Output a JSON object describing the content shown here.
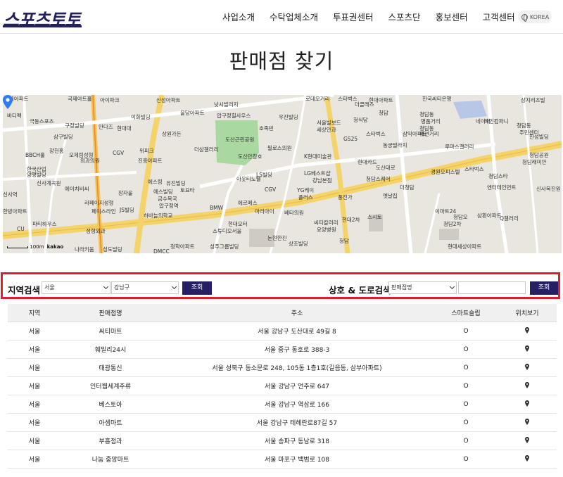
{
  "header": {
    "logo": "스포츠토토",
    "nav": [
      "사업소개",
      "수탁업체소개",
      "투표권센터",
      "스포츠단",
      "홍보센터",
      "고객센터"
    ],
    "lang": "KOREA"
  },
  "page_title": "판매점 찾기",
  "map": {
    "labels": [
      {
        "t": "현대아파트"
      },
      {
        "t": "국제아트홀"
      },
      {
        "t": "아이파크"
      },
      {
        "t": "신성아파트"
      },
      {
        "t": "낫시빌리지"
      },
      {
        "t": "로데오거리"
      },
      {
        "t": "스타벅스"
      },
      {
        "t": "현대아파트"
      },
      {
        "t": "한국씨티은행"
      },
      {
        "t": "상지리츠빌"
      },
      {
        "t": "바디펙"
      },
      {
        "t": "극동스포츠"
      },
      {
        "t": "구정빌딩"
      },
      {
        "t": "삼구빌딩"
      },
      {
        "t": "안다즈"
      },
      {
        "t": "현대대"
      },
      {
        "t": "이화빌딩"
      },
      {
        "t": "을당아파트"
      },
      {
        "t": "압구정힐사우스"
      },
      {
        "t": "우진빌딩"
      },
      {
        "t": "더클래스"
      },
      {
        "t": "청담"
      },
      {
        "t": "청담동"
      },
      {
        "t": "명품거리"
      },
      {
        "t": "청담동"
      },
      {
        "t": "패션거리"
      },
      {
        "t": "네이처"
      },
      {
        "t": "상원가든"
      },
      {
        "t": "호족빈"
      },
      {
        "t": "서울빌보드"
      },
      {
        "t": "세상안과"
      },
      {
        "t": "청식당"
      },
      {
        "t": "스타벅스"
      },
      {
        "t": "삼익아파트"
      },
      {
        "t": "레인컴파니"
      },
      {
        "t": "청담동"
      },
      {
        "t": "주민센터"
      },
      {
        "t": "한성빌딩"
      },
      {
        "t": "장천홍"
      },
      {
        "t": "모제림성형"
      },
      {
        "t": "외과의원"
      },
      {
        "t": "CGV"
      },
      {
        "t": "위피크"
      },
      {
        "t": "더삼갤러리"
      },
      {
        "t": "도산근린공원"
      },
      {
        "t": "필로스의원"
      },
      {
        "t": "GS25"
      },
      {
        "t": "동궁빌라지"
      },
      {
        "t": "루마스갤러리"
      },
      {
        "t": "BBCH홀"
      },
      {
        "t": "진흥아파트"
      },
      {
        "t": "도산안창호"
      },
      {
        "t": "K현대미술관"
      },
      {
        "t": "현대카드"
      },
      {
        "t": "청담공원"
      },
      {
        "t": "청담래미안"
      },
      {
        "t": "한국산업"
      },
      {
        "t": "양행빌딩"
      },
      {
        "t": "신사계곡원"
      },
      {
        "t": "에스림"
      },
      {
        "t": "LS빌딩"
      },
      {
        "t": "LG베스트샵"
      },
      {
        "t": "강남본점"
      },
      {
        "t": "도산대로"
      },
      {
        "t": "경원오피스텔"
      },
      {
        "t": "스타벅스"
      },
      {
        "t": "에이치비씨"
      },
      {
        "t": "장자울"
      },
      {
        "t": "유진빌딩"
      },
      {
        "t": "에스빌딩"
      },
      {
        "t": "토요타"
      },
      {
        "t": "아웃티노웰"
      },
      {
        "t": "CGV"
      },
      {
        "t": "YG케이"
      },
      {
        "t": "플러스"
      },
      {
        "t": "청담스퀘어"
      },
      {
        "t": "더청담"
      },
      {
        "t": "청담스타"
      },
      {
        "t": "엔터테인먼트"
      },
      {
        "t": "신사복진원"
      },
      {
        "t": "신사역"
      },
      {
        "t": "라페이지성형"
      },
      {
        "t": "금수복국"
      },
      {
        "t": "BMW"
      },
      {
        "t": "에르메스"
      },
      {
        "t": "마리아이"
      },
      {
        "t": "베타의원"
      },
      {
        "t": "풍전가"
      },
      {
        "t": "옛날집"
      },
      {
        "t": "이마트24"
      },
      {
        "t": "삼환아파트"
      },
      {
        "t": "한방아파트"
      },
      {
        "t": "JS빌딩"
      },
      {
        "t": "압구정역"
      },
      {
        "t": "하바늘의학교"
      },
      {
        "t": "청담오"
      },
      {
        "t": "파티하우스"
      },
      {
        "t": "페이스라인"
      },
      {
        "t": "성형외과"
      },
      {
        "t": "현대모터"
      },
      {
        "t": "스튜디오서울"
      },
      {
        "t": "씨티칼러리"
      },
      {
        "t": "요양병원"
      },
      {
        "t": "현대2차"
      },
      {
        "t": "스시토"
      },
      {
        "t": "청담2차"
      },
      {
        "t": "Q갤러리"
      },
      {
        "t": "CU"
      },
      {
        "t": "나라키움"
      },
      {
        "t": "성도빌딩"
      },
      {
        "t": "DMCC"
      },
      {
        "t": "청학아파트"
      },
      {
        "t": "성주그룹빌딩"
      },
      {
        "t": "논현한진"
      },
      {
        "t": "상조빌딩"
      },
      {
        "t": "청담"
      },
      {
        "t": "현대세상아파트"
      }
    ],
    "scale_text": "100m",
    "provider": "kakao"
  },
  "search": {
    "region_label": "지역검색",
    "region_city": "서울",
    "region_district": "강남구",
    "region_button": "조회",
    "name_label": "상호 & 도로검색",
    "name_type": "판매점명",
    "name_value": "",
    "name_button": "조회"
  },
  "table": {
    "headers": [
      "지역",
      "판매점명",
      "주소",
      "스마트슬립",
      "위치보기"
    ],
    "rows": [
      {
        "region": "서울",
        "name": "씨티마트",
        "address": "서울 강남구 도산대로 49길 8",
        "smart": "O"
      },
      {
        "region": "서울",
        "name": "훼밀리24시",
        "address": "서울 중구 동호로 388-3",
        "smart": "O"
      },
      {
        "region": "서울",
        "name": "태광통신",
        "address": "서울 성북구 동소문로 248, 105동 1층1호(길음동, 삼부아파트)",
        "smart": "O"
      },
      {
        "region": "서울",
        "name": "인터웹세계주류",
        "address": "서울 강남구 언주로 647",
        "smart": "O"
      },
      {
        "region": "서울",
        "name": "베스토아",
        "address": "서울 강남구 역삼로 166",
        "smart": "O"
      },
      {
        "region": "서울",
        "name": "아셈마트",
        "address": "서울 강남구 테헤란로87길 57",
        "smart": "O"
      },
      {
        "region": "서울",
        "name": "부흥점과",
        "address": "서울 송파구 동남로 318",
        "smart": "O"
      },
      {
        "region": "서울",
        "name": "나눔 중앙마트",
        "address": "서울 마포구 백범로 108",
        "smart": "O"
      }
    ]
  }
}
